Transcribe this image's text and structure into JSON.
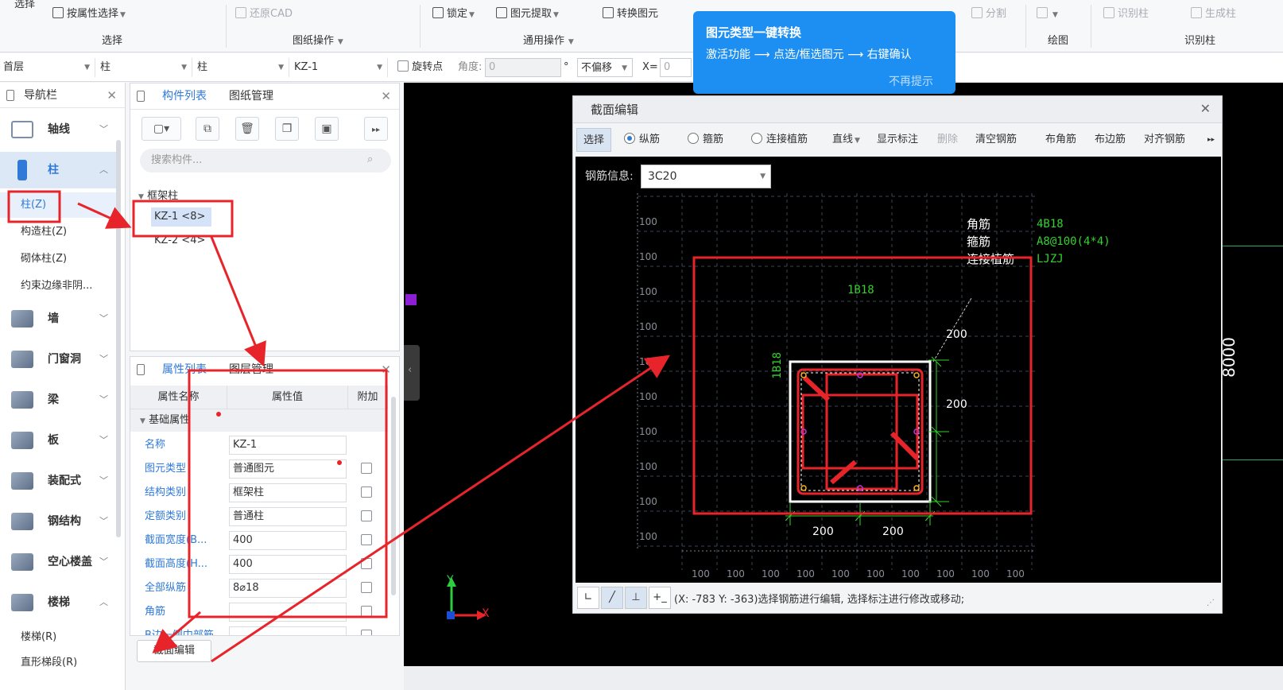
{
  "ribbon": {
    "select_top": "选择",
    "by_attr": "按属性选择",
    "restore_cad": "还原CAD",
    "lock": "锁定",
    "extract": "图元提取",
    "convert": "转换图元",
    "split": "分割",
    "identify_col": "识别柱",
    "gen_col": "生成柱",
    "groups": {
      "select": "选择",
      "drawing_ops": "图纸操作",
      "common_ops": "通用操作",
      "draw": "绘图",
      "identify": "识别柱"
    }
  },
  "toolbar2": {
    "floor": "首层",
    "cat1": "柱",
    "cat2": "柱",
    "comp": "KZ-1",
    "rotate_label": "旋转点",
    "angle_label": "角度:",
    "angle_value": "0",
    "degree": "°",
    "offset": "不偏移",
    "x_label": "X=",
    "x_value": "0"
  },
  "tooltip": {
    "title": "图元类型一键转换",
    "body": "激活功能 ⟶ 点选/框选图元 ⟶ 右键确认",
    "dismiss": "不再提示"
  },
  "nav": {
    "title": "导航栏",
    "cats": [
      {
        "label": "轴线"
      },
      {
        "label": "柱"
      },
      {
        "label": "墙"
      },
      {
        "label": "门窗洞"
      },
      {
        "label": "梁"
      },
      {
        "label": "板"
      },
      {
        "label": "装配式"
      },
      {
        "label": "钢结构"
      },
      {
        "label": "空心楼盖"
      },
      {
        "label": "楼梯"
      }
    ],
    "col_subs": [
      "柱(Z)",
      "构造柱(Z)",
      "砌体柱(Z)",
      "约束边缘非阴..."
    ],
    "stair_subs": [
      "楼梯(R)",
      "直形梯段(R)"
    ]
  },
  "comp_panel": {
    "tab_list": "构件列表",
    "tab_drawing": "图纸管理",
    "search_placeholder": "搜索构件...",
    "group": "框架柱",
    "items": [
      "KZ-1 <8>",
      "KZ-2 <4>"
    ]
  },
  "prop_panel": {
    "tab_props": "属性列表",
    "tab_layers": "图层管理",
    "col_name": "属性名称",
    "col_value": "属性值",
    "col_extra": "附加",
    "section": "基础属性",
    "rows": [
      {
        "name": "名称",
        "value": "KZ-1"
      },
      {
        "name": "图元类型",
        "value": "普通图元"
      },
      {
        "name": "结构类别",
        "value": "框架柱"
      },
      {
        "name": "定额类别",
        "value": "普通柱"
      },
      {
        "name": "截面宽度(B...",
        "value": "400"
      },
      {
        "name": "截面高度(H...",
        "value": "400"
      },
      {
        "name": "全部纵筋",
        "value": "8⌀18"
      },
      {
        "name": "角筋",
        "value": ""
      },
      {
        "name": "B边一侧中部筋",
        "value": ""
      }
    ],
    "edit_button": "截面编辑"
  },
  "canvas": {
    "dim_right": "8000",
    "axis_y": "Y",
    "axis_x": "X"
  },
  "dialog": {
    "title": "截面编辑",
    "toolbar": {
      "select": "选择",
      "long_bar": "纵筋",
      "stirrup": "箍筋",
      "anchor": "连接植筋",
      "line": "直线",
      "show_label": "显示标注",
      "delete": "删除",
      "clear": "清空钢筋",
      "corner_bar": "布角筋",
      "edge_bar": "布边筋",
      "align_bar": "对齐钢筋"
    },
    "rebar_info_label": "钢筋信息:",
    "rebar_info_value": "3C20",
    "legend": [
      {
        "label": "角筋",
        "value": "4B18"
      },
      {
        "label": "箍筋",
        "value": "A8@100(4*4)"
      },
      {
        "label": "连接植筋",
        "value": "LJZJ"
      }
    ],
    "top_label": "1B18",
    "left_label": "1B18",
    "dims": [
      "200",
      "200",
      "200",
      "200"
    ],
    "grid_label": "100",
    "status": "(X: -783 Y: -363)选择钢筋进行编辑, 选择标注进行修改或移动;"
  },
  "colors": {
    "accent": "#2f7ad9",
    "annotation_red": "#e8242b",
    "rebar_green": "#33d12c",
    "tooltip_blue": "#1e8ff2"
  }
}
